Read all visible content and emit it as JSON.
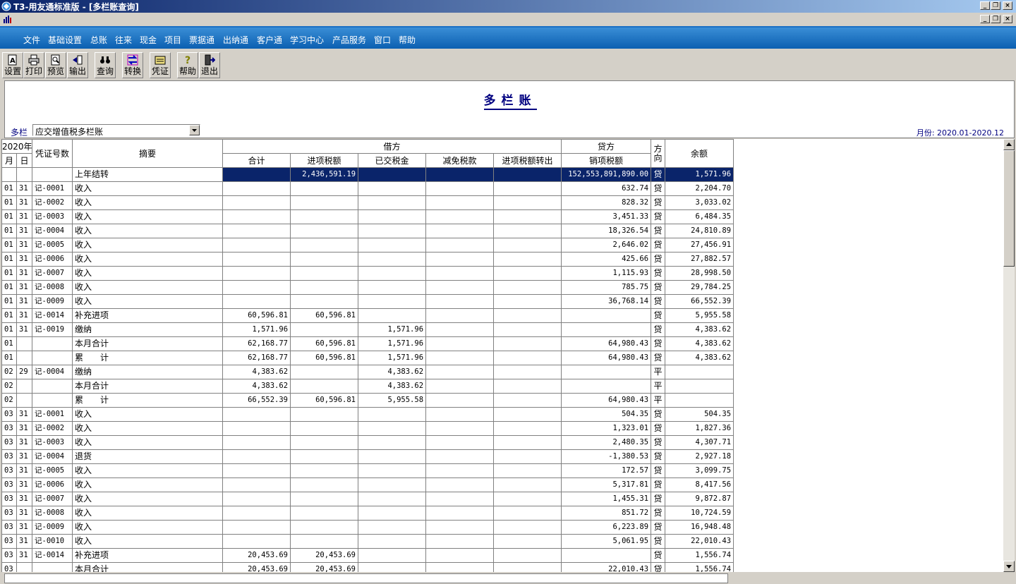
{
  "window": {
    "title": "T3-用友通标准版 - [多栏账查询]",
    "colors": {
      "title_bar": "#0a246a",
      "menu_bar": "#0b5fb1",
      "highlight": "#0a246a",
      "header_text": "#000080"
    }
  },
  "menu": [
    "文件",
    "基础设置",
    "总账",
    "往来",
    "现金",
    "项目",
    "票据通",
    "出纳通",
    "客户通",
    "学习中心",
    "产品服务",
    "窗口",
    "帮助"
  ],
  "toolbar": {
    "settings": "设置",
    "print": "打印",
    "preview": "预览",
    "export": "输出",
    "query": "查询",
    "convert": "转换",
    "voucher": "凭证",
    "help": "帮助",
    "exit": "退出"
  },
  "report": {
    "title": "多栏账",
    "dropdown_label": "多栏",
    "dropdown_value": "应交增值税多栏账",
    "period": "月份: 2020.01-2020.12"
  },
  "table": {
    "headers": {
      "year": "2020年",
      "month": "月",
      "day": "日",
      "voucher_no": "凭证号数",
      "summary": "摘要",
      "debit": "借方",
      "credit": "贷方",
      "direction": "方向",
      "balance": "余额",
      "debit_cols": [
        "合计",
        "进项税额",
        "已交税金",
        "减免税款",
        "进项税额转出"
      ],
      "credit_cols": [
        "销项税额"
      ]
    },
    "rows": [
      [
        "",
        "",
        "",
        "上年结转",
        "",
        "2,436,591.19",
        "",
        "",
        "",
        "152,553,891,890.00",
        "贷",
        "1,571.96"
      ],
      [
        "01",
        "31",
        "记-0001",
        "收入",
        "",
        "",
        "",
        "",
        "",
        "632.74",
        "贷",
        "2,204.70"
      ],
      [
        "01",
        "31",
        "记-0002",
        "收入",
        "",
        "",
        "",
        "",
        "",
        "828.32",
        "贷",
        "3,033.02"
      ],
      [
        "01",
        "31",
        "记-0003",
        "收入",
        "",
        "",
        "",
        "",
        "",
        "3,451.33",
        "贷",
        "6,484.35"
      ],
      [
        "01",
        "31",
        "记-0004",
        "收入",
        "",
        "",
        "",
        "",
        "",
        "18,326.54",
        "贷",
        "24,810.89"
      ],
      [
        "01",
        "31",
        "记-0005",
        "收入",
        "",
        "",
        "",
        "",
        "",
        "2,646.02",
        "贷",
        "27,456.91"
      ],
      [
        "01",
        "31",
        "记-0006",
        "收入",
        "",
        "",
        "",
        "",
        "",
        "425.66",
        "贷",
        "27,882.57"
      ],
      [
        "01",
        "31",
        "记-0007",
        "收入",
        "",
        "",
        "",
        "",
        "",
        "1,115.93",
        "贷",
        "28,998.50"
      ],
      [
        "01",
        "31",
        "记-0008",
        "收入",
        "",
        "",
        "",
        "",
        "",
        "785.75",
        "贷",
        "29,784.25"
      ],
      [
        "01",
        "31",
        "记-0009",
        "收入",
        "",
        "",
        "",
        "",
        "",
        "36,768.14",
        "贷",
        "66,552.39"
      ],
      [
        "01",
        "31",
        "记-0014",
        "补充进项",
        "60,596.81",
        "60,596.81",
        "",
        "",
        "",
        "",
        "贷",
        "5,955.58"
      ],
      [
        "01",
        "31",
        "记-0019",
        "缴纳",
        "1,571.96",
        "",
        "1,571.96",
        "",
        "",
        "",
        "贷",
        "4,383.62"
      ],
      [
        "01",
        "",
        "",
        "本月合计",
        "62,168.77",
        "60,596.81",
        "1,571.96",
        "",
        "",
        "64,980.43",
        "贷",
        "4,383.62"
      ],
      [
        "01",
        "",
        "",
        "累　　计",
        "62,168.77",
        "60,596.81",
        "1,571.96",
        "",
        "",
        "64,980.43",
        "贷",
        "4,383.62"
      ],
      [
        "02",
        "29",
        "记-0004",
        "缴纳",
        "4,383.62",
        "",
        "4,383.62",
        "",
        "",
        "",
        "平",
        ""
      ],
      [
        "02",
        "",
        "",
        "本月合计",
        "4,383.62",
        "",
        "4,383.62",
        "",
        "",
        "",
        "平",
        ""
      ],
      [
        "02",
        "",
        "",
        "累　　计",
        "66,552.39",
        "60,596.81",
        "5,955.58",
        "",
        "",
        "64,980.43",
        "平",
        ""
      ],
      [
        "03",
        "31",
        "记-0001",
        "收入",
        "",
        "",
        "",
        "",
        "",
        "504.35",
        "贷",
        "504.35"
      ],
      [
        "03",
        "31",
        "记-0002",
        "收入",
        "",
        "",
        "",
        "",
        "",
        "1,323.01",
        "贷",
        "1,827.36"
      ],
      [
        "03",
        "31",
        "记-0003",
        "收入",
        "",
        "",
        "",
        "",
        "",
        "2,480.35",
        "贷",
        "4,307.71"
      ],
      [
        "03",
        "31",
        "记-0004",
        "退货",
        "",
        "",
        "",
        "",
        "",
        "-1,380.53",
        "贷",
        "2,927.18"
      ],
      [
        "03",
        "31",
        "记-0005",
        "收入",
        "",
        "",
        "",
        "",
        "",
        "172.57",
        "贷",
        "3,099.75"
      ],
      [
        "03",
        "31",
        "记-0006",
        "收入",
        "",
        "",
        "",
        "",
        "",
        "5,317.81",
        "贷",
        "8,417.56"
      ],
      [
        "03",
        "31",
        "记-0007",
        "收入",
        "",
        "",
        "",
        "",
        "",
        "1,455.31",
        "贷",
        "9,872.87"
      ],
      [
        "03",
        "31",
        "记-0008",
        "收入",
        "",
        "",
        "",
        "",
        "",
        "851.72",
        "贷",
        "10,724.59"
      ],
      [
        "03",
        "31",
        "记-0009",
        "收入",
        "",
        "",
        "",
        "",
        "",
        "6,223.89",
        "贷",
        "16,948.48"
      ],
      [
        "03",
        "31",
        "记-0010",
        "收入",
        "",
        "",
        "",
        "",
        "",
        "5,061.95",
        "贷",
        "22,010.43"
      ],
      [
        "03",
        "31",
        "记-0014",
        "补充进项",
        "20,453.69",
        "20,453.69",
        "",
        "",
        "",
        "",
        "贷",
        "1,556.74"
      ],
      [
        "03",
        "",
        "",
        "本月合计",
        "20,453.69",
        "20,453.69",
        "",
        "",
        "",
        "22,010.43",
        "贷",
        "1,556.74"
      ]
    ],
    "selected_row": 0
  }
}
